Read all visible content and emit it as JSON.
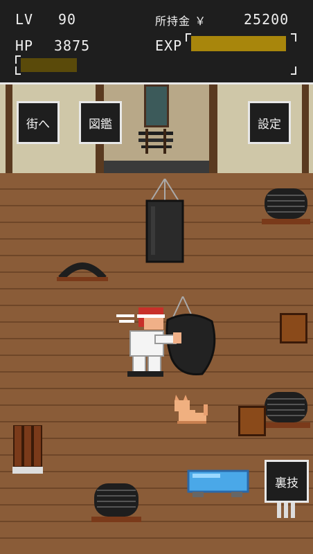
{
  "hud": {
    "lv_label": "LV",
    "lv_value": "90",
    "money_label": "所持金 ￥",
    "money_value": "25200",
    "hp_label": "HP",
    "hp_value": "3875",
    "exp_label": "EXP",
    "exp_fill_fraction": 0.95,
    "hp_fill_fraction": 0.44
  },
  "buttons": {
    "town": "街へ",
    "encyclopedia": "図鑑",
    "settings": "設定",
    "secret_move": "裏技"
  },
  "colors": {
    "hud_bg": "#1e1e1e",
    "bar_gold": "#a8860c",
    "floor": "#8a5c38"
  }
}
